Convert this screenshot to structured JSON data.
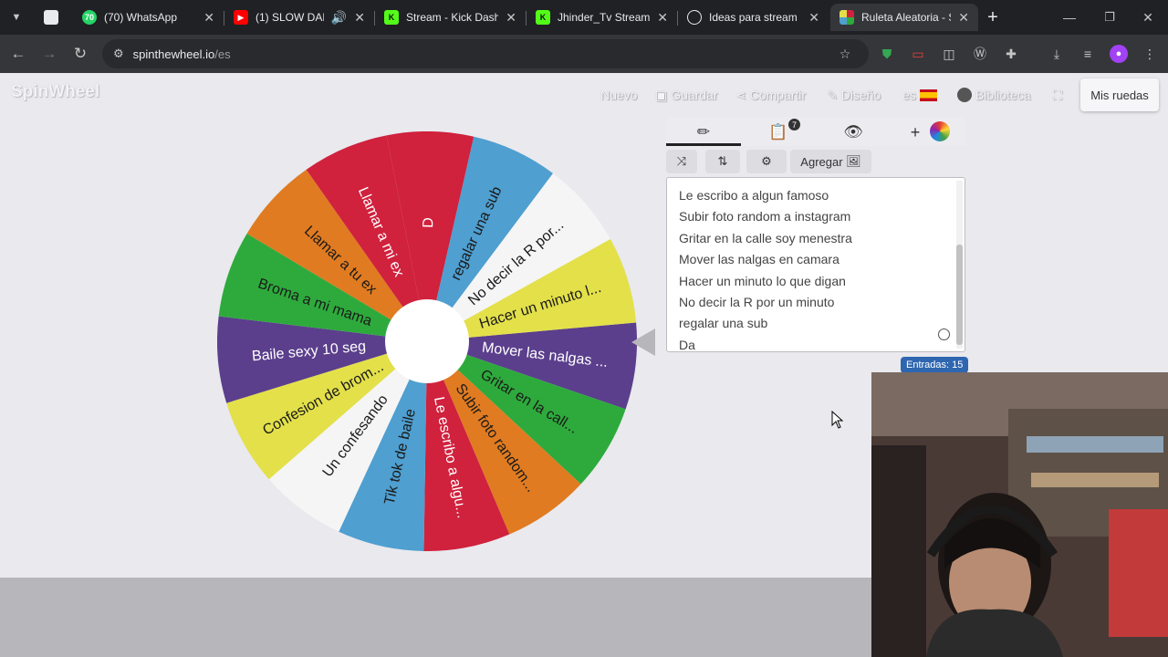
{
  "browser": {
    "tabs": [
      {
        "title": "",
        "icon": "page-icon",
        "color": "#e8eaed"
      },
      {
        "title": "(70) WhatsApp",
        "icon": "whatsapp-icon",
        "color": "#25d366",
        "badge": "70"
      },
      {
        "title": "(1) SLOW DANC",
        "icon": "youtube-icon",
        "color": "#ff0000"
      },
      {
        "title": "Stream - Kick Dashb",
        "icon": "kick-icon",
        "color": "#53fc18"
      },
      {
        "title": "Jhinder_Tv Stream -",
        "icon": "kick-icon",
        "color": "#53fc18"
      },
      {
        "title": "Ideas para stream",
        "icon": "openai-icon",
        "color": "#e8eaed"
      },
      {
        "title": "Ruleta Aleatoria - S",
        "icon": "spinthewheel-icon",
        "color": "#e8eaed"
      }
    ],
    "new_tab": "+",
    "url_host": "spinthewheel.io",
    "url_path": "/es"
  },
  "app": {
    "logo": "SpinWheel",
    "menu": {
      "nuevo": "Nuevo",
      "guardar": "Guardar",
      "compartir": "Compartir",
      "diseno": "Diseño",
      "lang": "es",
      "biblioteca": "Biblioteca"
    },
    "mis_ruedas": "Mis ruedas",
    "toolbar": {
      "badge": "7",
      "agregar": "Agregar"
    },
    "entries_count": "Entradas: 15",
    "entries": [
      "Le escribo a algun famoso",
      "Subir foto random a instagram",
      "Gritar en la calle soy menestra",
      "Mover las nalgas en camara",
      "Hacer un minuto lo que digan",
      "No decir la R por un minuto",
      "regalar una sub",
      "Da"
    ]
  },
  "wheel": {
    "segments": [
      {
        "label": "Mover las nalgas ...",
        "color": "#5b3f8c",
        "text": "#ffffff"
      },
      {
        "label": "Gritar en la call...",
        "color": "#2eaa3c",
        "text": "#1a1a1a"
      },
      {
        "label": "Subir foto random...",
        "color": "#e07b21",
        "text": "#1a1a1a"
      },
      {
        "label": "Le escribo a algu...",
        "color": "#d0213d",
        "text": "#ffffff"
      },
      {
        "label": "Tik tok  de baile",
        "color": "#4f9fd0",
        "text": "#1a1a1a"
      },
      {
        "label": "Un confesando",
        "color": "#f5f5f5",
        "text": "#1a1a1a"
      },
      {
        "label": "Confesion de brom...",
        "color": "#e3e04a",
        "text": "#1a1a1a"
      },
      {
        "label": "Baile sexy 10 seg",
        "color": "#5b3f8c",
        "text": "#ffffff"
      },
      {
        "label": "Broma a mi mama",
        "color": "#2eaa3c",
        "text": "#1a1a1a"
      },
      {
        "label": "Llamar a tu ex",
        "color": "#e07b21",
        "text": "#1a1a1a"
      },
      {
        "label": "Llamar a mi ex",
        "color": "#d0213d",
        "text": "#ffffff"
      },
      {
        "label": "D",
        "color": "#d0213d",
        "text": "#ffffff"
      },
      {
        "label": "regalar una sub",
        "color": "#4f9fd0",
        "text": "#1a1a1a"
      },
      {
        "label": "No decir la R por...",
        "color": "#f5f5f5",
        "text": "#1a1a1a"
      },
      {
        "label": "Hacer un minuto l...",
        "color": "#e3e04a",
        "text": "#1a1a1a"
      }
    ]
  }
}
